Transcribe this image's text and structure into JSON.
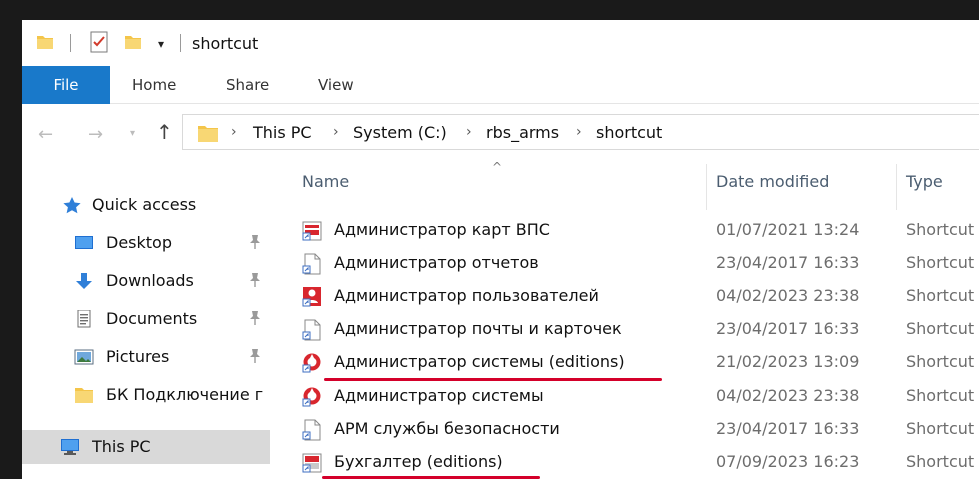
{
  "window": {
    "title": "shortcut"
  },
  "ribbon": {
    "tabs": [
      "File",
      "Home",
      "Share",
      "View"
    ]
  },
  "address": {
    "crumbs": [
      "This PC",
      "System (C:)",
      "rbs_arms",
      "shortcut"
    ]
  },
  "sidebar": {
    "items": [
      {
        "label": "Quick access",
        "icon": "star-icon"
      },
      {
        "label": "Desktop",
        "icon": "desktop-icon",
        "pinned": true
      },
      {
        "label": "Downloads",
        "icon": "download-arrow-icon",
        "pinned": true
      },
      {
        "label": "Documents",
        "icon": "document-icon",
        "pinned": true
      },
      {
        "label": "Pictures",
        "icon": "pictures-icon",
        "pinned": true
      },
      {
        "label": "БК Подключение г",
        "icon": "folder-icon"
      },
      {
        "label": "This PC",
        "icon": "computer-icon",
        "selected": true
      }
    ]
  },
  "columns": {
    "name": "Name",
    "date": "Date modified",
    "type": "Type"
  },
  "files": [
    {
      "name": "Администратор карт ВПС",
      "date": "01/07/2021 13:24",
      "type": "Shortcut",
      "icon": "card-admin-shortcut-icon"
    },
    {
      "name": "Администратор отчетов",
      "date": "23/04/2017 16:33",
      "type": "Shortcut",
      "icon": "generic-shortcut-icon"
    },
    {
      "name": "Администратор пользователей",
      "date": "04/02/2023 23:38",
      "type": "Shortcut",
      "icon": "user-admin-shortcut-icon"
    },
    {
      "name": "Администратор почты и карточек",
      "date": "23/04/2017 16:33",
      "type": "Shortcut",
      "icon": "generic-shortcut-icon"
    },
    {
      "name": "Администратор системы (editions)",
      "date": "21/02/2023 13:09",
      "type": "Shortcut",
      "icon": "system-admin-shortcut-icon",
      "underlined": true
    },
    {
      "name": "Администратор системы",
      "date": "04/02/2023 23:38",
      "type": "Shortcut",
      "icon": "system-admin-shortcut-icon"
    },
    {
      "name": "АРМ службы безопасности",
      "date": "23/04/2017 16:33",
      "type": "Shortcut",
      "icon": "generic-shortcut-icon"
    },
    {
      "name": "Бухгалтер (editions)",
      "date": "07/09/2023 16:23",
      "type": "Shortcut",
      "icon": "accountant-shortcut-icon",
      "underlined": true
    }
  ],
  "colors": {
    "accent": "#1979ca",
    "annotation": "#d4002a",
    "selection": "#d9d9d9"
  }
}
